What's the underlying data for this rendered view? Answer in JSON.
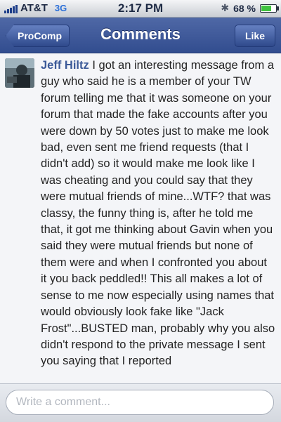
{
  "status_bar": {
    "carrier": "AT&T",
    "network": "3G",
    "time": "2:17 PM",
    "battery_percent_label": "68 %",
    "battery_level": 0.68,
    "icons": [
      "signal-bars-icon",
      "bluetooth-icon",
      "battery-icon"
    ]
  },
  "nav": {
    "back_label": "ProComp",
    "title": "Comments",
    "like_label": "Like"
  },
  "comment": {
    "author": "Jeff Hiltz",
    "text": "I got an interesting message from a guy who said he is a member of your TW forum telling me that it was someone on your forum that made the fake accounts after you were down by 50 votes just to make me look bad, even sent me friend requests (that I didn't add) so it would make me look like I was cheating and you could say that they were mutual friends of mine...WTF? that was classy, the funny thing is, after he told me that, it got me thinking about Gavin when you said they were mutual friends but none of them were and when I confronted you about it you back peddled!! This all makes a lot of sense to me now especially using names that would obviously look fake like \"Jack Frost\"...BUSTED man, probably why you also didn't respond to the private message I sent you saying that I reported"
  },
  "input": {
    "placeholder": "Write a comment...",
    "value": ""
  },
  "colors": {
    "nav_bar": "#3b5998",
    "author_link": "#3b5998",
    "network_badge": "#2b6fd8",
    "battery_fill": "#3fc23f"
  }
}
